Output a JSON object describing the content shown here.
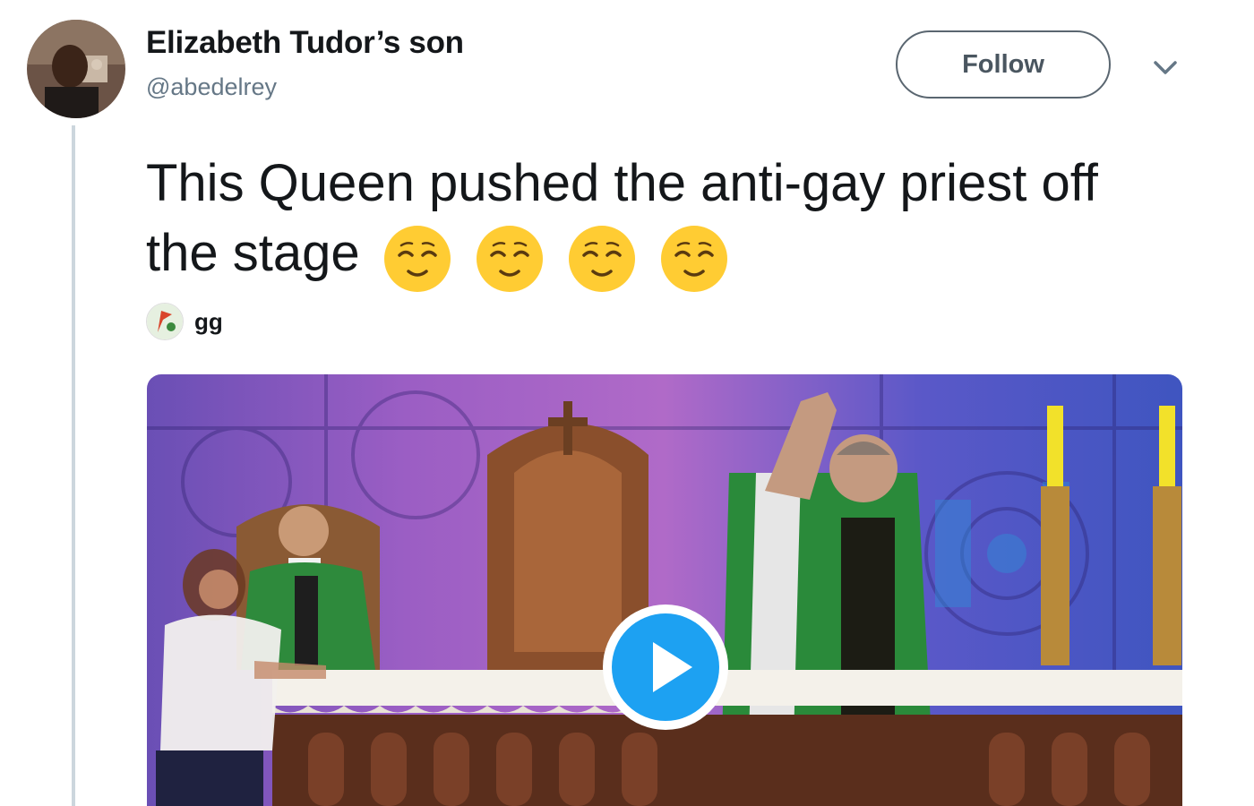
{
  "tweet": {
    "author": {
      "display_name": "Elizabeth Tudor’s son",
      "handle": "@abedelrey"
    },
    "follow_label": "Follow",
    "text": "This Queen pushed the anti-gay priest off the stage",
    "emojis": [
      "relieved-face",
      "relieved-face",
      "relieved-face",
      "relieved-face"
    ],
    "quote": {
      "name": "gg"
    },
    "media": {
      "type": "video"
    }
  },
  "colors": {
    "accent": "#1da1f2",
    "follow_border": "#5a6670",
    "handle": "#657786",
    "thread_line": "#ccd6dd",
    "emoji": "#ffcc33"
  }
}
